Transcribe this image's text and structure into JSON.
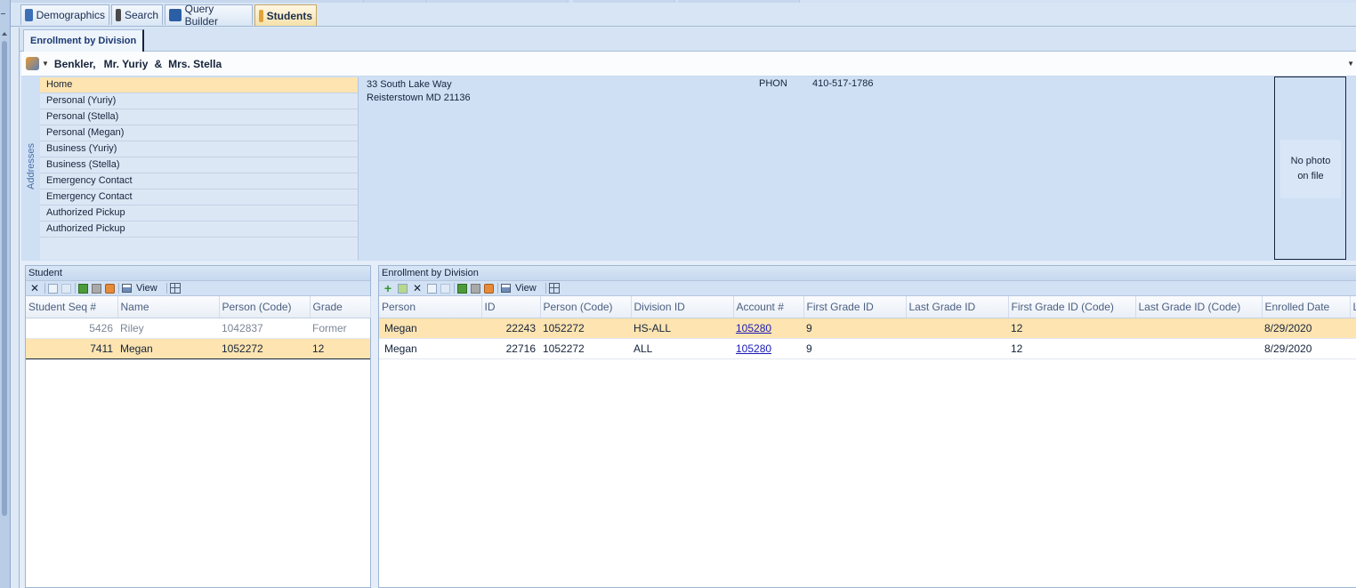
{
  "main_tabs": [
    {
      "label": "Demographics",
      "icon": "book-icon"
    },
    {
      "label": "Search",
      "icon": "binoculars-icon"
    },
    {
      "label": "Query Builder",
      "icon": "chart-icon"
    },
    {
      "label": "Students",
      "icon": "students-icon",
      "active": true
    }
  ],
  "sub_tab": "Enrollment by Division",
  "person": {
    "last_name": "Benkler,",
    "name1": "Mr. Yuriy",
    "amp": "&",
    "name2": "Mrs. Stella"
  },
  "addresses": {
    "vertical_label": "Addresses",
    "items": [
      "Home",
      "Personal (Yuriy)",
      "Personal (Stella)",
      "Personal (Megan)",
      "Business (Yuriy)",
      "Business (Stella)",
      "Emergency Contact",
      "Emergency Contact",
      "Authorized Pickup",
      "Authorized Pickup"
    ],
    "selected": "Home",
    "line1": "33 South Lake Way",
    "line2": "Reisterstown MD 21136",
    "phone_label": "PHON",
    "phone_value": "410-517-1786",
    "photo_line1": "No photo",
    "photo_line2": "on file"
  },
  "student_panel": {
    "title": "Student",
    "view_label": "View",
    "columns": [
      "Student Seq #",
      "Name",
      "Person (Code)",
      "Grade"
    ],
    "rows": [
      {
        "seq": "5426",
        "name": "Riley",
        "code": "1042837",
        "grade": "Former"
      },
      {
        "seq": "7411",
        "name": "Megan",
        "code": "1052272",
        "grade": "12"
      }
    ]
  },
  "enroll_panel": {
    "title": "Enrollment by Division",
    "view_label": "View",
    "columns": [
      "Person",
      "ID",
      "Person (Code)",
      "Division ID",
      "Account #",
      "First Grade ID",
      "Last Grade ID",
      "First Grade ID (Code)",
      "Last Grade ID (Code)",
      "Enrolled Date",
      "L"
    ],
    "rows": [
      {
        "person": "Megan",
        "id": "22243",
        "code": "1052272",
        "division": "HS-ALL",
        "account": "105280",
        "first_grade": "9",
        "last_grade": "",
        "first_grade_code": "12",
        "last_grade_code": "",
        "enrolled": "8/29/2020"
      },
      {
        "person": "Megan",
        "id": "22716",
        "code": "1052272",
        "division": "ALL",
        "account": "105280",
        "first_grade": "9",
        "last_grade": "",
        "first_grade_code": "12",
        "last_grade_code": "",
        "enrolled": "8/29/2020"
      }
    ]
  },
  "colors": {
    "selection": "#fde4b0",
    "panel_bg": "#cfe0f5",
    "link": "#1a1ab8"
  }
}
